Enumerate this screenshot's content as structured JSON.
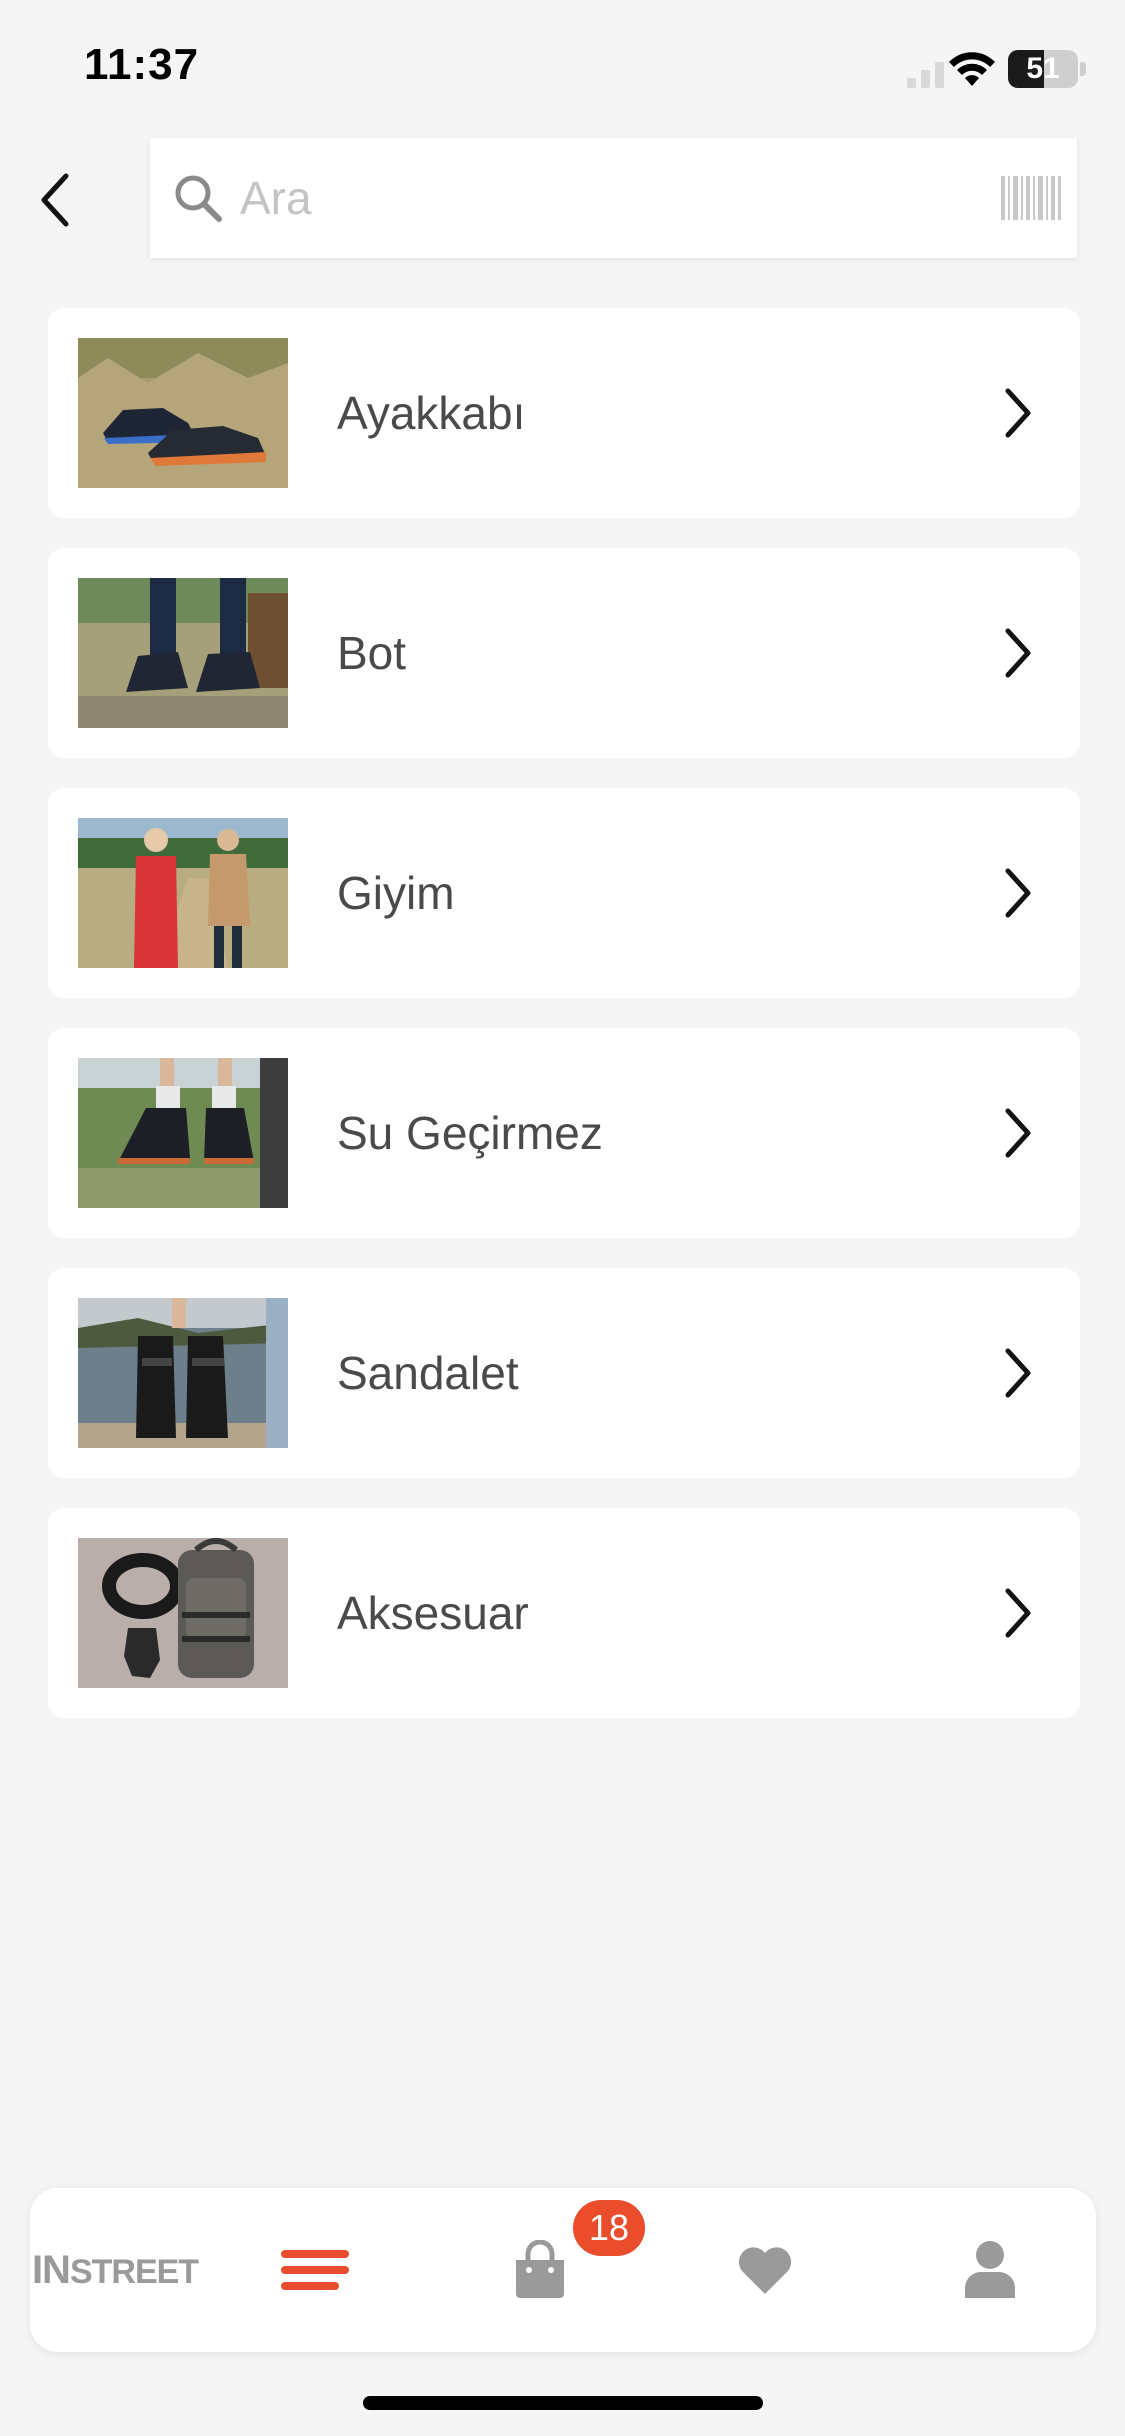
{
  "status_bar": {
    "time": "11:37",
    "battery_level": "51"
  },
  "search": {
    "placeholder": "Ara",
    "value": ""
  },
  "categories": [
    {
      "label": "Ayakkabı"
    },
    {
      "label": "Bot"
    },
    {
      "label": "Giyim"
    },
    {
      "label": "Su Geçirmez"
    },
    {
      "label": "Sandalet"
    },
    {
      "label": "Aksesuar"
    }
  ],
  "tab_bar": {
    "logo": {
      "part1": "IN",
      "part2": "STREET"
    },
    "cart_badge": "18",
    "active_tab": "menu"
  },
  "colors": {
    "accent": "#ea4d2c",
    "background": "#f5f5f5",
    "card": "#ffffff",
    "text": "#4a4a4a",
    "inactive_icon": "#9a9a9a"
  },
  "icons": {
    "back": "chevron-left-icon",
    "search": "search-icon",
    "barcode": "barcode-icon",
    "row_chevron": "chevron-right-icon",
    "menu": "menu-icon",
    "cart": "shopping-bag-icon",
    "favorites": "heart-icon",
    "account": "user-icon"
  }
}
